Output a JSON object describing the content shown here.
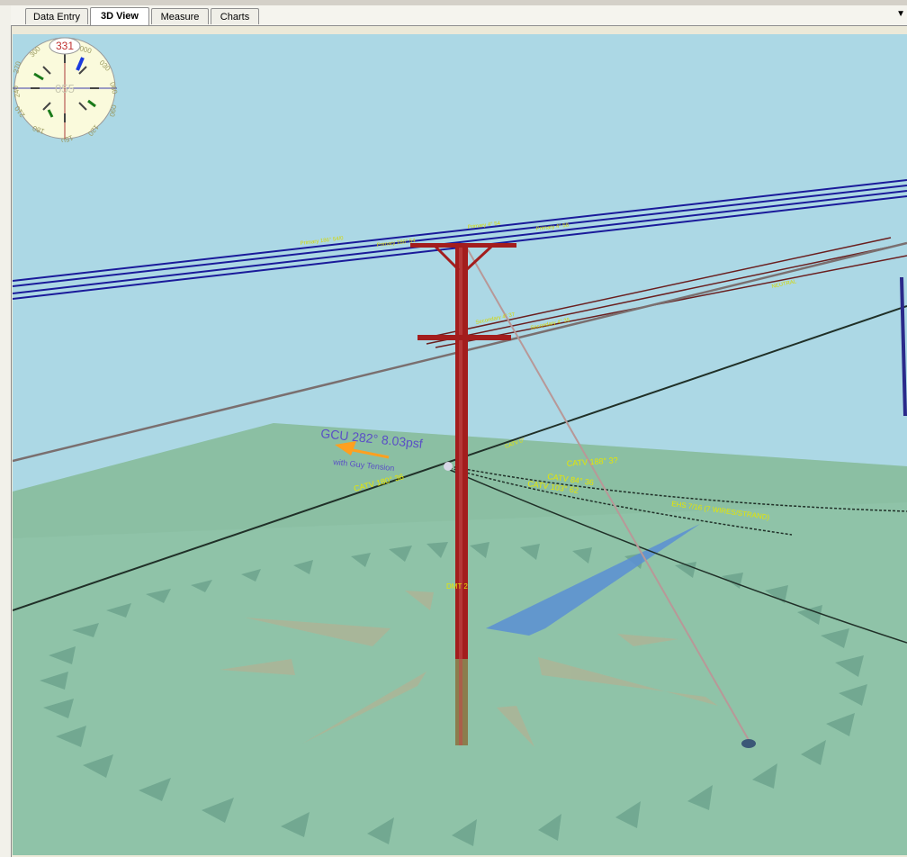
{
  "tabs": [
    {
      "label": "Data Entry",
      "active": false
    },
    {
      "label": "3D View",
      "active": true
    },
    {
      "label": "Measure",
      "active": false
    },
    {
      "label": "Charts",
      "active": false
    }
  ],
  "compass": {
    "top_reading": "331",
    "center_reading": "055",
    "dial_labels": [
      "300",
      "270",
      "240",
      "210",
      "180",
      "150",
      "120",
      "090",
      "060",
      "030",
      "000"
    ]
  },
  "load_case": {
    "title": "GCU 282° 8.03psf",
    "subtitle": "with Guy Tension"
  },
  "labels": {
    "pole": "DMT 2",
    "guy": "EHS 7/16 (7 WIRES/STRAND)",
    "catv_1": "CATV 84° 36",
    "catv_2": "CATV 103° 62",
    "catv_3": "CATV 188° 3?",
    "catv_4": "CATV 180° 36",
    "neutral": "NEUTRAL"
  },
  "colors": {
    "sky": "#acd8e5",
    "ground": "#8fc3a8",
    "pole": "#a31d1d",
    "primary": "#1a1a9a",
    "secondary": "#6a1e1e",
    "label": "#e6e600",
    "load_text": "#5a4fc6",
    "arrow": "#ffa020"
  }
}
